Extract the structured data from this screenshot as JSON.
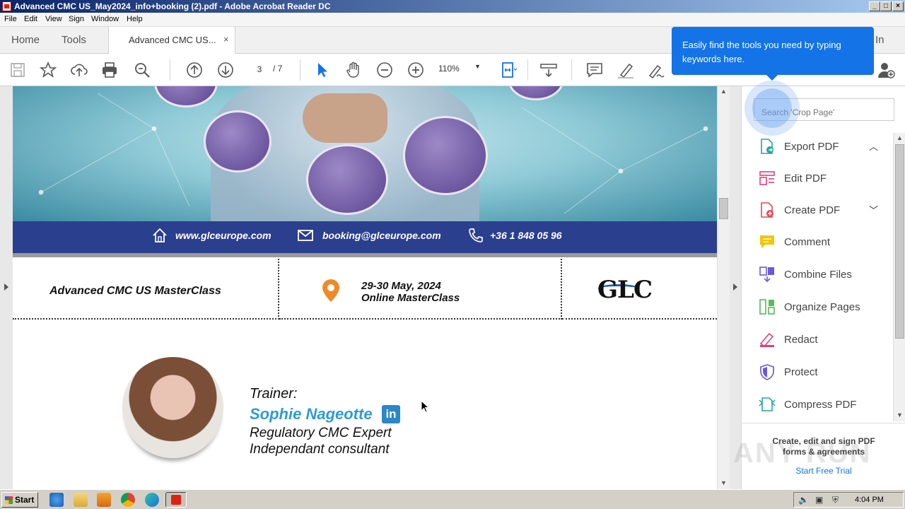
{
  "window": {
    "title": "Advanced CMC US_May2024_info+booking (2).pdf - Adobe Acrobat Reader DC",
    "controls": [
      "_",
      "□",
      "×"
    ]
  },
  "menu": [
    "File",
    "Edit",
    "View",
    "Sign",
    "Window",
    "Help"
  ],
  "tabs": {
    "home": "Home",
    "tools": "Tools",
    "document": "Advanced CMC US...",
    "close": "×",
    "sign_in": "In"
  },
  "toolbar": {
    "page_current": "3",
    "page_total": "/ 7",
    "zoom": "110%"
  },
  "tooltip": {
    "text": "Easily find the tools you need by typing keywords here."
  },
  "pdf": {
    "contacts": {
      "website": "www.glceurope.com",
      "email": "booking@glceurope.com",
      "phone": "+36 1 848 05 96"
    },
    "course_title": "Advanced CMC US MasterClass",
    "dates_line1": "29-30 May, 2024",
    "dates_line2": "Online MasterClass",
    "logo_text": "GLC",
    "trainer_label": "Trainer:",
    "trainer_name": "Sophie Nageotte",
    "linkedin": "in",
    "trainer_role1": "Regulatory CMC Expert",
    "trainer_role2": "Independant consultant"
  },
  "right_panel": {
    "search_placeholder": "Search 'Crop Page'",
    "tools": [
      {
        "label": "Export PDF",
        "icon": "export-pdf-icon",
        "color": "#26a69a",
        "expanded": true
      },
      {
        "label": "Edit PDF",
        "icon": "edit-pdf-icon",
        "color": "#e0407b"
      },
      {
        "label": "Create PDF",
        "icon": "create-pdf-icon",
        "color": "#e34850",
        "expanded": false
      },
      {
        "label": "Comment",
        "icon": "comment-icon",
        "color": "#f5c400"
      },
      {
        "label": "Combine Files",
        "icon": "combine-files-icon",
        "color": "#6b5ad8"
      },
      {
        "label": "Organize Pages",
        "icon": "organize-pages-icon",
        "color": "#5cb85c"
      },
      {
        "label": "Redact",
        "icon": "redact-icon",
        "color": "#e0407b"
      },
      {
        "label": "Protect",
        "icon": "protect-icon",
        "color": "#6b5ad8"
      },
      {
        "label": "Compress PDF",
        "icon": "compress-pdf-icon",
        "color": "#26a69a"
      }
    ],
    "promo_line1": "Create, edit and sign PDF",
    "promo_line2": "forms & agreements",
    "promo_cta": "Start Free Trial",
    "watermark": "ANY RUN"
  },
  "taskbar": {
    "start": "Start",
    "clock": "4:04 PM"
  }
}
